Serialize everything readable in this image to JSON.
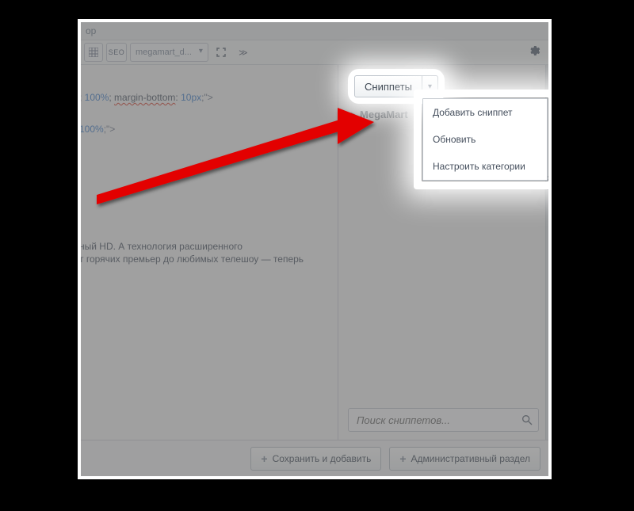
{
  "title": "ор",
  "toolbar": {
    "seo_label": "SEO",
    "file_name": "megamart_d..."
  },
  "code": {
    "line1_prefix": "; ",
    "line1_num": "100%",
    "line1_mid": "; ",
    "line1_attr": "margin-bottom",
    "line1_sep": ": ",
    "line1_val": "10px",
    "line1_end": ";\">",
    "line2_prefix": " ",
    "line2_num": "100%",
    "line2_end": ";\">"
  },
  "editor_text": {
    "l1": "ный HD. А технология расширенного",
    "l2": "т горячих премьер до любимых телешоу — теперь"
  },
  "snippets": {
    "button_label": "Сниппеты",
    "category": "MegaMart",
    "menu": {
      "add": "Добавить сниппет",
      "refresh": "Обновить",
      "configure": "Настроить категории"
    },
    "search_placeholder": "Поиск сниппетов..."
  },
  "footer": {
    "save_add": "Сохранить и добавить",
    "admin": "Административный раздел"
  }
}
